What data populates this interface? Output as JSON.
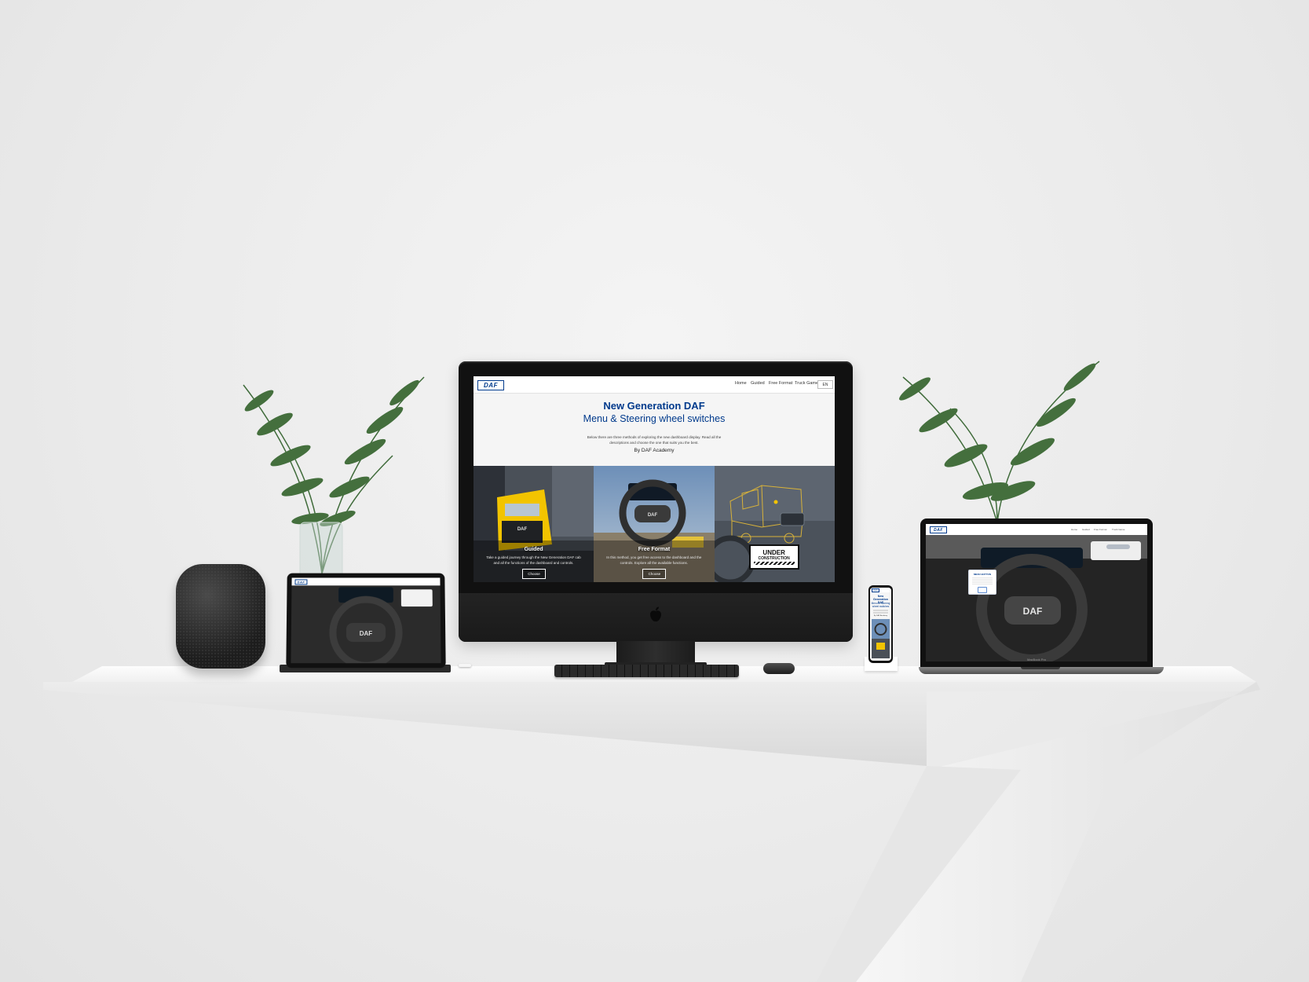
{
  "site": {
    "logo": "DAF",
    "nav": [
      "Home",
      "Guided",
      "Free Format",
      "Truck Game"
    ],
    "lang": "EN",
    "title": "New Generation DAF",
    "subtitle": "Menu & Steering wheel switches",
    "description": "Below there are three methods of exploring the new dashboard display. Read all the descriptions and choose the one that suits you the best.",
    "author": "By DAF Academy",
    "cards": [
      {
        "title": "Guided",
        "text": "Take a guided journey through the New Generation DAF cab and all the functions of the dashboard and controls.",
        "button": "Choose"
      },
      {
        "title": "Free Format",
        "text": "In this method, you get free access to the dashboard and the controls. Explore all the available functions.",
        "button": "Choose"
      },
      {
        "badge_line1": "UNDER",
        "badge_line2": "CONSTRUCTION"
      }
    ]
  },
  "phone_site": {
    "title_line1": "New Generation",
    "title_line2": "DAF",
    "subtitle_line1": "Menu & Steering",
    "subtitle_line2": "wheel switches",
    "author": "By DAF Academy"
  },
  "laptop_site": {
    "popup_title": "MENU BUTTON",
    "model": "MacBook Pro"
  },
  "colors": {
    "daf_blue": "#003a8c",
    "truck_yellow": "#f2c400"
  }
}
